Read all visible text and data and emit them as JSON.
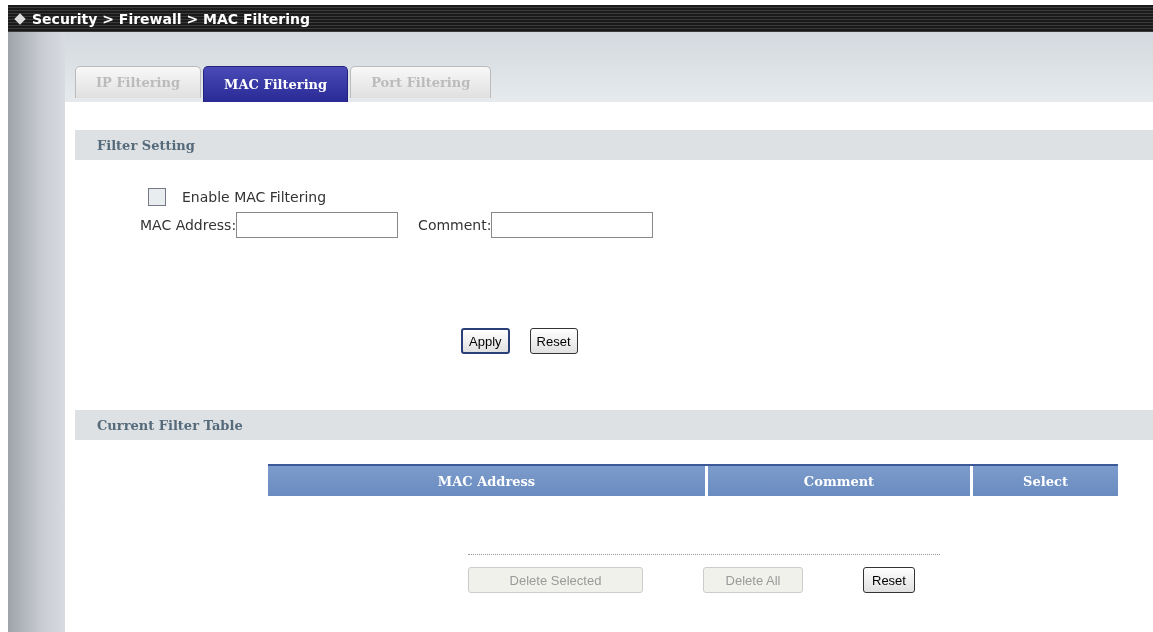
{
  "breadcrumb": "Security > Firewall > MAC Filtering",
  "tabs": [
    {
      "label": "IP Filtering",
      "selected": false
    },
    {
      "label": "MAC Filtering",
      "selected": true
    },
    {
      "label": "Port Filtering",
      "selected": false
    }
  ],
  "filter_setting": {
    "title": "Filter Setting",
    "enable": {
      "label": "Enable MAC Filtering",
      "checked": false
    },
    "fields": [
      {
        "label": "MAC Address:"
      },
      {
        "label": "Comment:"
      }
    ],
    "buttons": [
      {
        "label": "Apply",
        "disabled": false,
        "default": true
      },
      {
        "label": "Reset",
        "disabled": false,
        "default": false
      }
    ]
  },
  "filter_table": {
    "title": "Current Filter Table",
    "columns": [
      "MAC Address",
      "Comment",
      "Select"
    ],
    "buttons": [
      {
        "label": "Delete Selected",
        "disabled": true
      },
      {
        "label": "Delete All",
        "disabled": true
      },
      {
        "label": "Reset",
        "disabled": false
      }
    ]
  }
}
